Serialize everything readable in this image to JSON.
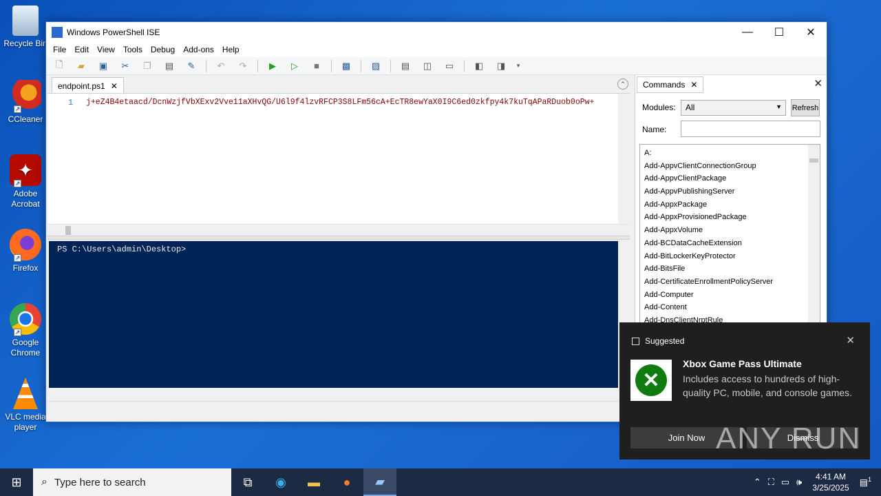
{
  "desktop": {
    "icons": [
      {
        "label": "Recycle Bin",
        "icon": "recycle-bin-icon"
      },
      {
        "label": "CCleaner",
        "icon": "ccleaner-icon"
      },
      {
        "label": "Adobe Acrobat",
        "icon": "acrobat-icon"
      },
      {
        "label": "Firefox",
        "icon": "firefox-icon"
      },
      {
        "label": "Google Chrome",
        "icon": "chrome-icon"
      },
      {
        "label": "VLC media player",
        "icon": "vlc-icon"
      }
    ]
  },
  "window": {
    "title": "Windows PowerShell ISE",
    "menu": [
      "File",
      "Edit",
      "View",
      "Tools",
      "Debug",
      "Add-ons",
      "Help"
    ]
  },
  "editor": {
    "tab_label": "endpoint.ps1",
    "line_number": "1",
    "code_line": "j+eZ4B4etaacd/DcnWzjfVbXExv2Vve11aXHvQG/U6l9f4lzvRFCP3S8LFm56cA+EcTR8ewYaX0I9C6ed0zkfpy4k7kuTqAPaRDuob0oPw+"
  },
  "console": {
    "prompt": "PS C:\\Users\\admin\\Desktop>"
  },
  "commands_pane": {
    "tab_label": "Commands",
    "modules_label": "Modules:",
    "modules_value": "All",
    "refresh_label": "Refresh",
    "name_label": "Name:",
    "name_value": "",
    "items": [
      "A:",
      "Add-AppvClientConnectionGroup",
      "Add-AppvClientPackage",
      "Add-AppvPublishingServer",
      "Add-AppxPackage",
      "Add-AppxProvisionedPackage",
      "Add-AppxVolume",
      "Add-BCDataCacheExtension",
      "Add-BitLockerKeyProtector",
      "Add-BitsFile",
      "Add-CertificateEnrollmentPolicyServer",
      "Add-Computer",
      "Add-Content",
      "Add-DnsClientNrptRule"
    ]
  },
  "toast": {
    "header": "Suggested",
    "title": "Xbox Game Pass Ultimate",
    "body": "Includes access to hundreds of high-quality PC, mobile, and console games.",
    "primary_button": "Join Now",
    "secondary_button": "Dismiss",
    "brand_color": "#107c10"
  },
  "watermark": "ANY RUN",
  "taskbar": {
    "search_placeholder": "Type here to search",
    "time": "4:41 AM",
    "date": "3/25/2025",
    "notification_count": "1"
  }
}
